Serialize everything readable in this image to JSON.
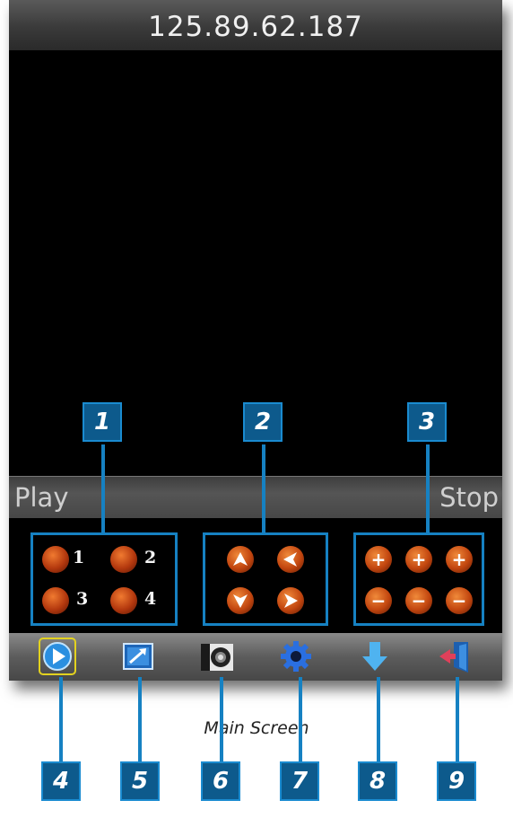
{
  "header": {
    "ip_address": "125.89.62.187"
  },
  "playbar": {
    "play_label": "Play",
    "stop_label": "Stop"
  },
  "channels": {
    "labels": [
      "1",
      "2",
      "3",
      "4"
    ]
  },
  "toolbar": {
    "icons": [
      "play-icon",
      "picture-icon",
      "camera-icon",
      "settings-icon",
      "download-icon",
      "exit-icon"
    ],
    "active_color": "#e3d21f"
  },
  "callouts": {
    "top": [
      "1",
      "2",
      "3"
    ],
    "bottom": [
      "4",
      "5",
      "6",
      "7",
      "8",
      "9"
    ]
  },
  "caption": "Main Screen",
  "colors": {
    "accent": "#1681c2",
    "callout_fill": "#0d5a8c",
    "orb": "#c2460f"
  }
}
